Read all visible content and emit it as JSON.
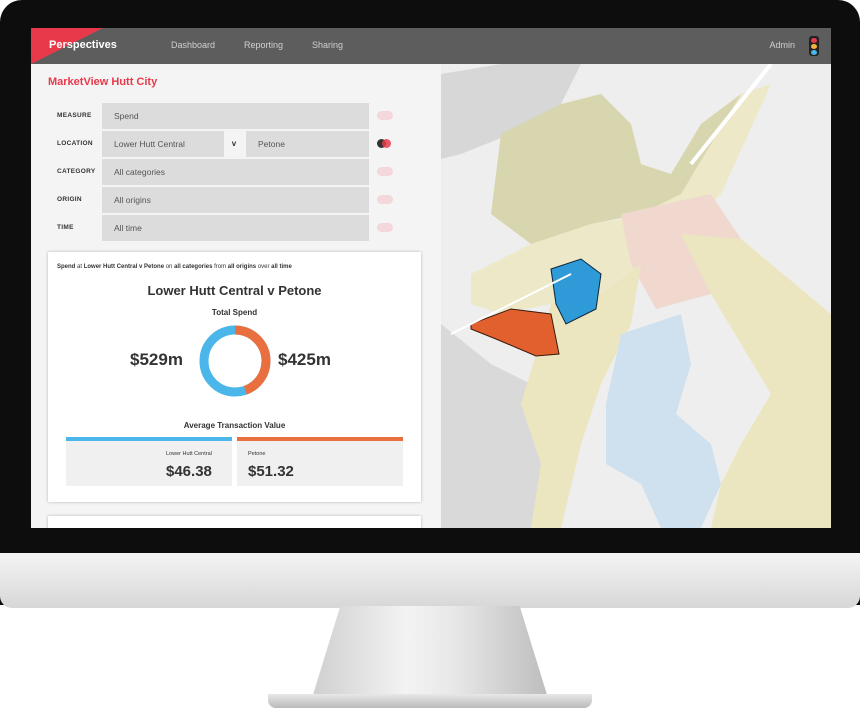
{
  "header": {
    "brand": "Perspectives",
    "nav": [
      "Dashboard",
      "Reporting",
      "Sharing"
    ],
    "user": "Admin",
    "colors": {
      "bar": "#5d5d5d",
      "brand_accent": "#e8394a"
    }
  },
  "app_title": "MarketView Hutt City",
  "filters": {
    "measure": {
      "label": "MEASURE",
      "value": "Spend"
    },
    "location": {
      "label": "LOCATION",
      "value_a": "Lower Hutt Central",
      "vs": "v",
      "value_b": "Petone"
    },
    "category": {
      "label": "CATEGORY",
      "value": "All categories"
    },
    "origin": {
      "label": "ORIGIN",
      "value": "All origins"
    },
    "time": {
      "label": "TIME",
      "value": "All time"
    }
  },
  "summary": {
    "measure": "Spend",
    "at": "at",
    "location": "Lower Hutt Central v Petone",
    "on": "on",
    "category": "all categories",
    "from": "from",
    "origin": "all origins",
    "over": "over",
    "time": "all time"
  },
  "comparison": {
    "title": "Lower Hutt Central v Petone",
    "total_label": "Total Spend",
    "total_a": "$529m",
    "total_b": "$425m",
    "donut_split": 0.555,
    "atv_label": "Average Transaction Value",
    "atv_a_label": "Lower Hutt Central",
    "atv_a_value": "$46.38",
    "atv_b_label": "Petone",
    "atv_b_value": "$51.32",
    "colors": {
      "a": "#4bb6ea",
      "b": "#ea6f3f"
    }
  }
}
